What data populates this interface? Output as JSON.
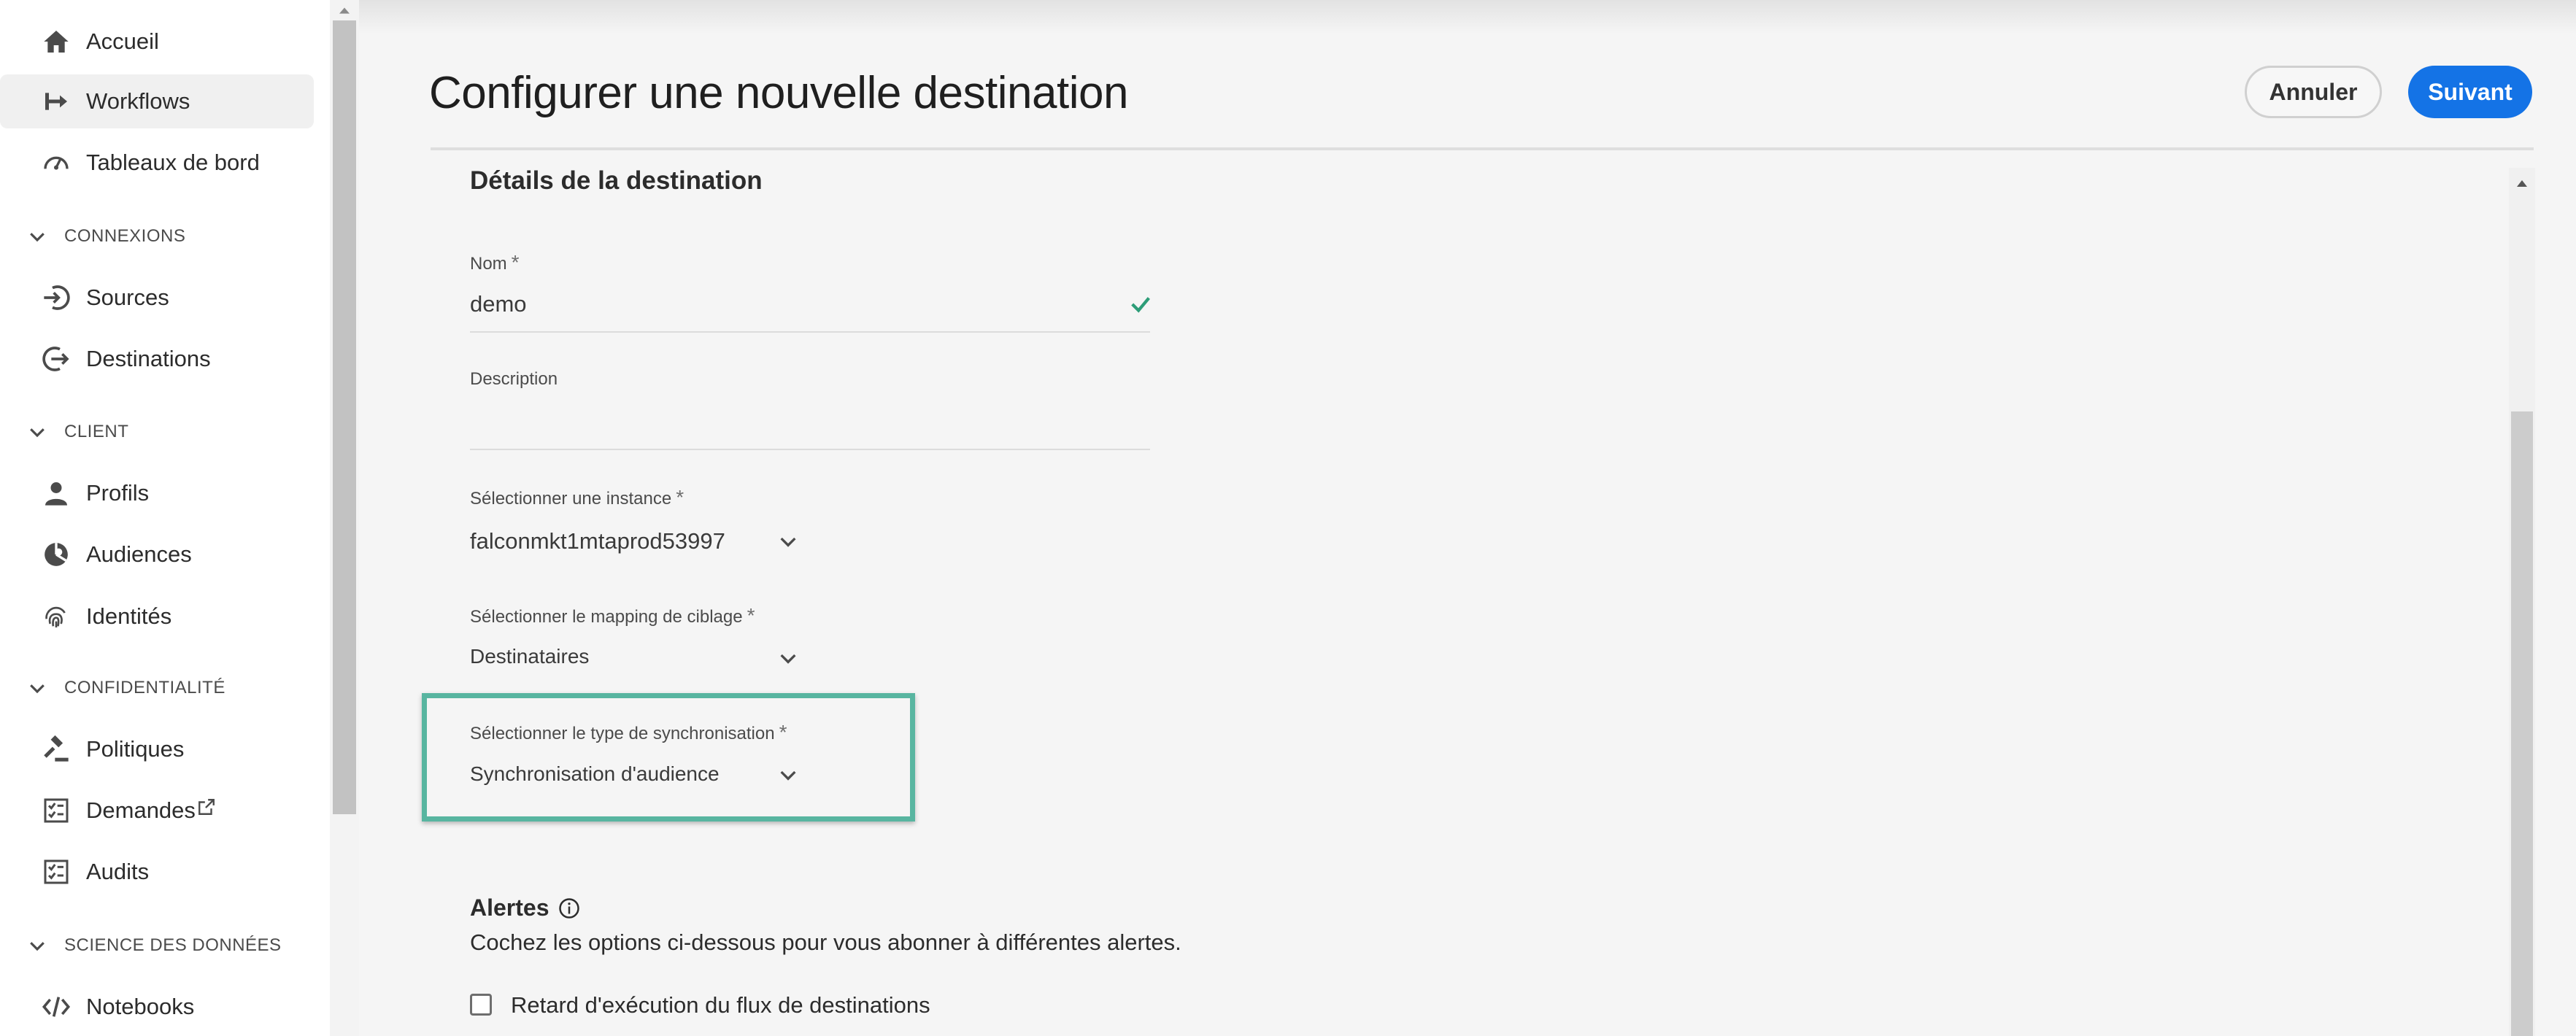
{
  "sidebar": {
    "items": [
      {
        "key": "home",
        "label": "Accueil",
        "icon": "home-icon"
      },
      {
        "key": "workflows",
        "label": "Workflows",
        "icon": "workflow-icon",
        "active": true
      },
      {
        "key": "dashboards",
        "label": "Tableaux de bord",
        "icon": "gauge-icon"
      }
    ],
    "sections": [
      {
        "title": "CONNEXIONS",
        "items": [
          {
            "label": "Sources",
            "icon": "sources-icon"
          },
          {
            "label": "Destinations",
            "icon": "destinations-icon"
          }
        ]
      },
      {
        "title": "CLIENT",
        "items": [
          {
            "label": "Profils",
            "icon": "user-icon"
          },
          {
            "label": "Audiences",
            "icon": "audiences-icon"
          },
          {
            "label": "Identités",
            "icon": "fingerprint-icon"
          }
        ]
      },
      {
        "title": "CONFIDENTIALITÉ",
        "items": [
          {
            "label": "Politiques",
            "icon": "gavel-icon"
          },
          {
            "label": "Demandes",
            "icon": "checklist-icon",
            "external": true
          },
          {
            "label": "Audits",
            "icon": "checklist-icon"
          }
        ]
      },
      {
        "title": "SCIENCE DES DONNÉES",
        "items": [
          {
            "label": "Notebooks",
            "icon": "code-icon"
          }
        ]
      }
    ]
  },
  "header": {
    "title": "Configurer une nouvelle destination",
    "cancel_label": "Annuler",
    "next_label": "Suivant"
  },
  "form": {
    "section_title": "Détails de la destination",
    "name": {
      "label": "Nom",
      "value": "demo",
      "valid": true
    },
    "description": {
      "label": "Description",
      "value": ""
    },
    "instance": {
      "label": "Sélectionner une instance",
      "value": "falconmkt1mtaprod53997"
    },
    "mapping": {
      "label": "Sélectionner le mapping de ciblage",
      "value": "Destinataires"
    },
    "sync_type": {
      "label": "Sélectionner le type de synchronisation",
      "value": "Synchronisation d'audience"
    },
    "required_mark": "*"
  },
  "alerts": {
    "title": "Alertes",
    "description": "Cochez les options ci-dessous pour vous abonner à différentes alertes.",
    "option_label": "Retard d'exécution du flux de destinations",
    "option_checked": false
  },
  "colors": {
    "accent": "#1473e6",
    "highlight": "#58b5a0",
    "valid": "#2d9d78"
  }
}
